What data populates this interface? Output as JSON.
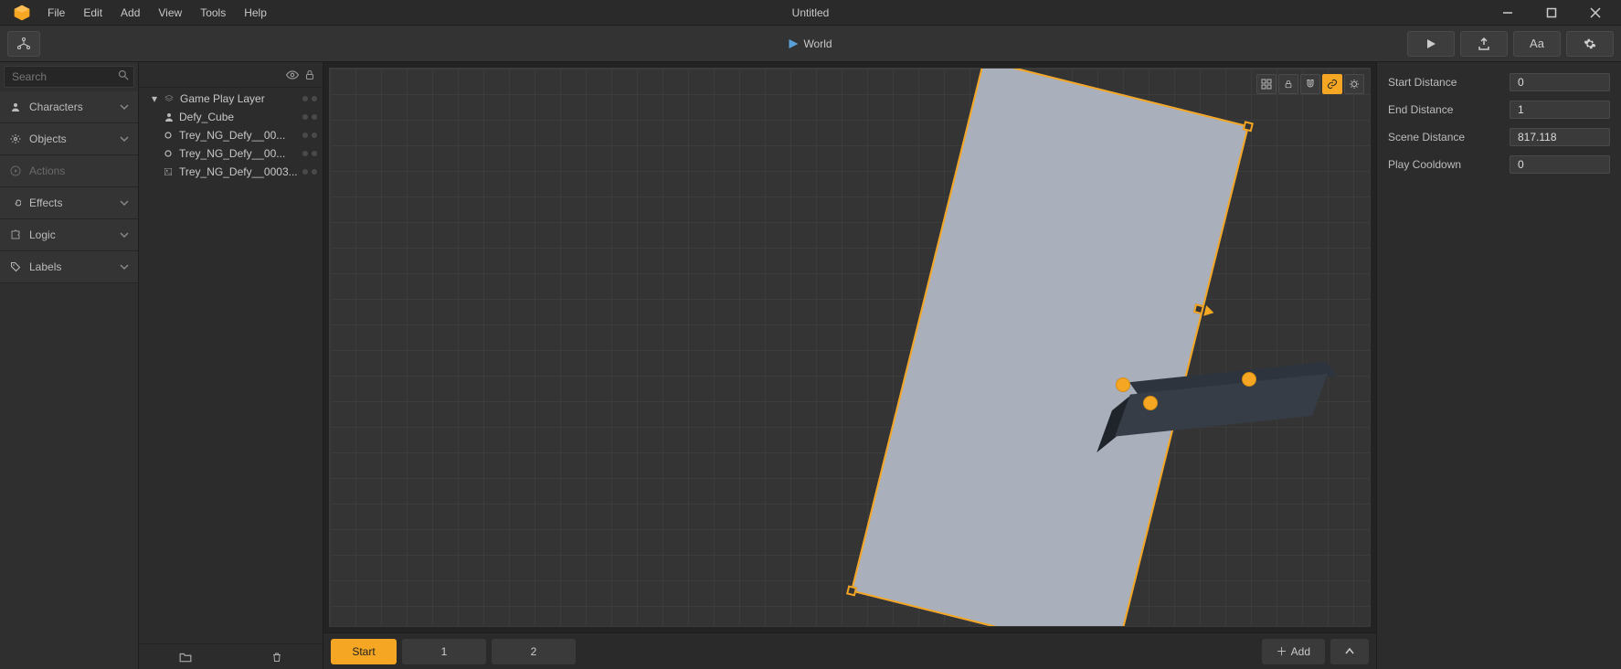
{
  "window": {
    "title": "Untitled",
    "menus": [
      "File",
      "Edit",
      "Add",
      "View",
      "Tools",
      "Help"
    ]
  },
  "toolbar": {
    "mode_label": "World"
  },
  "search": {
    "placeholder": "Search"
  },
  "sidebar": {
    "items": [
      {
        "icon": "person",
        "label": "Characters",
        "enabled": true,
        "expandable": true
      },
      {
        "icon": "gear",
        "label": "Objects",
        "enabled": true,
        "expandable": true
      },
      {
        "icon": "play",
        "label": "Actions",
        "enabled": false,
        "expandable": false
      },
      {
        "icon": "spiral",
        "label": "Effects",
        "enabled": true,
        "expandable": true
      },
      {
        "icon": "puzzle",
        "label": "Logic",
        "enabled": true,
        "expandable": true
      },
      {
        "icon": "tag",
        "label": "Labels",
        "enabled": true,
        "expandable": true
      }
    ]
  },
  "hierarchy": {
    "header_icons": [
      "eye",
      "lock"
    ],
    "nodes": [
      {
        "depth": 0,
        "icon": "layer",
        "name": "Game Play Layer",
        "expand": true
      },
      {
        "depth": 1,
        "icon": "person",
        "name": "Defy_Cube",
        "expand": false
      },
      {
        "depth": 1,
        "icon": "circle",
        "name": "Trey_NG_Defy__00...",
        "expand": false
      },
      {
        "depth": 1,
        "icon": "circle",
        "name": "Trey_NG_Defy__00...",
        "expand": false
      },
      {
        "depth": 1,
        "icon": "image",
        "name": "Trey_NG_Defy__0003...",
        "expand": false
      }
    ],
    "footer_icons": [
      "folder",
      "trash"
    ]
  },
  "viewport": {
    "top_icons": [
      {
        "name": "grid",
        "active": false
      },
      {
        "name": "lock",
        "active": false
      },
      {
        "name": "magnet",
        "active": false
      },
      {
        "name": "link",
        "active": true
      },
      {
        "name": "debug",
        "active": false
      }
    ]
  },
  "scenebar": {
    "start": "Start",
    "scenes": [
      "1",
      "2"
    ],
    "add": "Add"
  },
  "properties": {
    "rows": [
      {
        "label": "Start Distance",
        "value": "0"
      },
      {
        "label": "End Distance",
        "value": "1"
      },
      {
        "label": "Scene Distance",
        "value": "817.118"
      },
      {
        "label": "Play Cooldown",
        "value": "0"
      }
    ]
  }
}
